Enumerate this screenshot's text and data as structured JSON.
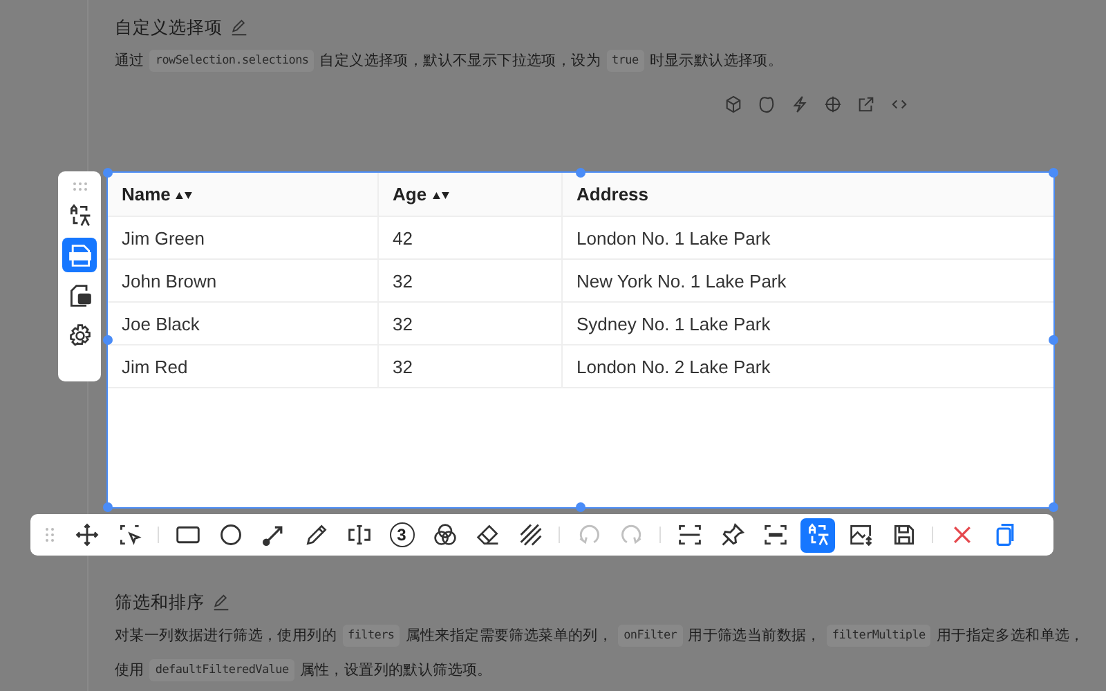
{
  "sections": [
    {
      "title": "自定义选择项",
      "lines": [
        [
          {
            "kind": "text",
            "text": "通过"
          },
          {
            "kind": "code",
            "text": "rowSelection.selections"
          },
          {
            "kind": "text",
            "text": "自定义选择项，默认不显示下拉选项，设为"
          },
          {
            "kind": "code",
            "text": "true"
          },
          {
            "kind": "text",
            "text": "时显示默认选择项。"
          }
        ]
      ]
    },
    {
      "title": "筛选和排序",
      "lines": [
        [
          {
            "kind": "text",
            "text": "对某一列数据进行筛选，使用列的"
          },
          {
            "kind": "code",
            "text": "filters"
          },
          {
            "kind": "text",
            "text": "属性来指定需要筛选菜单的列，"
          },
          {
            "kind": "code",
            "text": "onFilter"
          },
          {
            "kind": "text",
            "text": "用于筛选当前数据，"
          },
          {
            "kind": "code",
            "text": "filterMultiple"
          },
          {
            "kind": "text",
            "text": "用于指定多选和单选，"
          }
        ],
        [
          {
            "kind": "text",
            "text": "使用"
          },
          {
            "kind": "code",
            "text": "defaultFilteredValue"
          },
          {
            "kind": "text",
            "text": "属性，设置列的默认筛选项。"
          }
        ]
      ]
    }
  ],
  "table": {
    "columns": [
      {
        "label": "Name",
        "sortable": true
      },
      {
        "label": "Age",
        "sortable": true
      },
      {
        "label": "Address",
        "sortable": false
      }
    ],
    "rows": [
      [
        "Jim Green",
        "42",
        "London No. 1 Lake Park"
      ],
      [
        "John Brown",
        "32",
        "New York No. 1 Lake Park"
      ],
      [
        "Joe Black",
        "32",
        "Sydney No. 1 Lake Park"
      ],
      [
        "Jim Red",
        "32",
        "London No. 2 Lake Park"
      ]
    ]
  },
  "side_toolbar": [
    {
      "kind": "translate",
      "selected": false
    },
    {
      "kind": "html",
      "selected": true
    },
    {
      "kind": "markdown",
      "selected": false
    },
    {
      "kind": "settings",
      "selected": false
    }
  ],
  "toolbar": {
    "groups": [
      [
        {
          "kind": "move",
          "selected": false,
          "disabled": false
        },
        {
          "kind": "region-select",
          "selected": false,
          "disabled": false
        }
      ],
      [
        {
          "kind": "rectangle",
          "selected": false,
          "disabled": false
        },
        {
          "kind": "ellipse",
          "selected": false,
          "disabled": false
        },
        {
          "kind": "arrow",
          "selected": false,
          "disabled": false
        },
        {
          "kind": "pencil",
          "selected": false,
          "disabled": false
        },
        {
          "kind": "text",
          "selected": false,
          "disabled": false
        },
        {
          "kind": "number",
          "label": "3",
          "selected": false,
          "disabled": false
        },
        {
          "kind": "circles",
          "selected": false,
          "disabled": false
        },
        {
          "kind": "eraser",
          "selected": false,
          "disabled": false
        },
        {
          "kind": "mosaic",
          "selected": false,
          "disabled": false
        }
      ],
      [
        {
          "kind": "undo",
          "selected": false,
          "disabled": true
        },
        {
          "kind": "redo",
          "selected": false,
          "disabled": true
        }
      ],
      [
        {
          "kind": "scan",
          "selected": false,
          "disabled": false
        },
        {
          "kind": "pin",
          "selected": false,
          "disabled": false
        },
        {
          "kind": "ocr",
          "selected": false,
          "disabled": false
        },
        {
          "kind": "translate",
          "selected": true,
          "disabled": false
        },
        {
          "kind": "image-edit",
          "selected": false,
          "disabled": false
        },
        {
          "kind": "save",
          "selected": false,
          "disabled": false
        }
      ],
      [
        {
          "kind": "close",
          "selected": false,
          "disabled": false
        },
        {
          "kind": "copy",
          "selected": false,
          "disabled": false
        }
      ]
    ]
  }
}
